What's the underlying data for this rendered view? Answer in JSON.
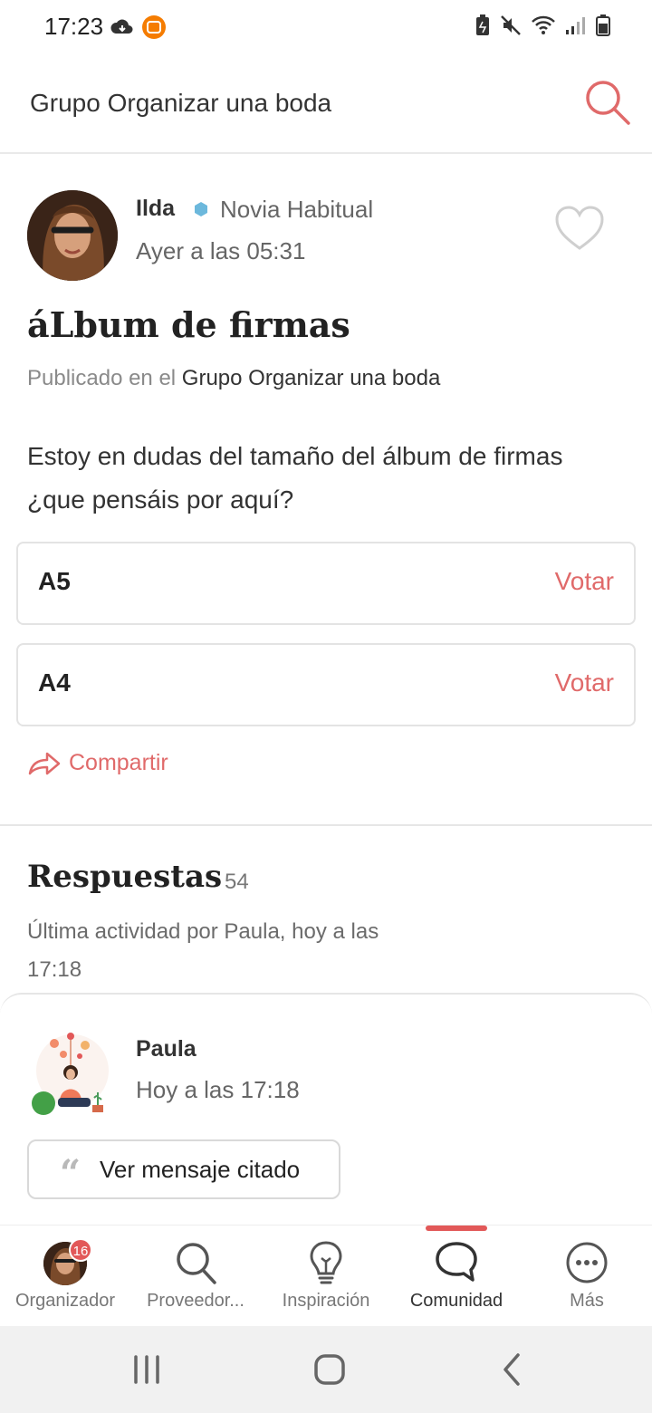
{
  "status_bar": {
    "time": "17:23",
    "icons": [
      "cloud-icon",
      "mi-app-icon",
      "battery-saver-icon",
      "mute-icon",
      "wifi-icon",
      "signal-icon",
      "battery-icon"
    ]
  },
  "header": {
    "title": "Grupo Organizar una boda",
    "search_icon": "search-icon"
  },
  "post": {
    "author_name": "Ilda",
    "author_role": "Novia Habitual",
    "time": "Ayer a las 05:31",
    "title": "áLbum de firmas",
    "published_prefix": "Publicado en el",
    "published_group": "Grupo Organizar una boda",
    "body": "Estoy en dudas del tamaño del álbum de firmas ¿que pensáis por aquí?",
    "poll_options": [
      {
        "label": "A5",
        "action": "Votar"
      },
      {
        "label": "A4",
        "action": "Votar"
      }
    ],
    "share_label": "Compartir"
  },
  "replies": {
    "title": "Respuestas",
    "count": "54",
    "last_activity": "Última actividad por Paula, hoy a las 17:18",
    "first_reply": {
      "author": "Paula",
      "time": "Hoy a las 17:18",
      "quote_label": "Ver mensaje citado"
    }
  },
  "bottom_nav": {
    "items": [
      {
        "label": "Organizador",
        "icon": "avatar-icon",
        "badge": "16"
      },
      {
        "label": "Proveedor...",
        "icon": "search-icon"
      },
      {
        "label": "Inspiración",
        "icon": "lightbulb-icon"
      },
      {
        "label": "Comunidad",
        "icon": "chat-bubble-icon",
        "active": true
      },
      {
        "label": "Más",
        "icon": "more-icon"
      }
    ]
  },
  "colors": {
    "accent": "#e06a6a",
    "badge": "#6cb8dc",
    "active_indicator": "#e25858"
  }
}
